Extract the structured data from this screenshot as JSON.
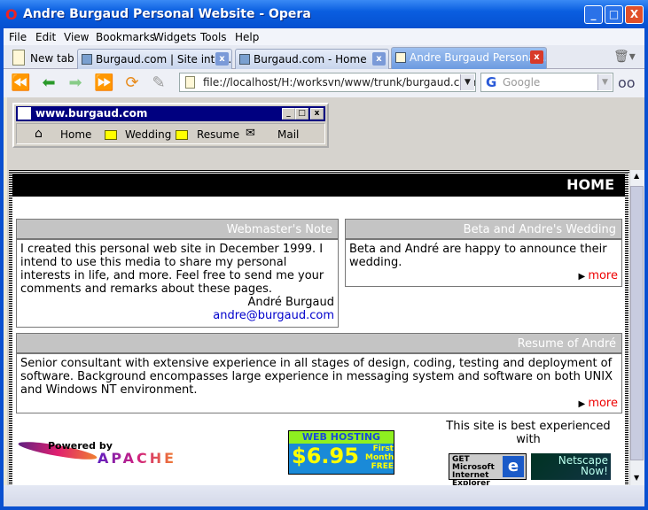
{
  "window": {
    "title": "Andre Burgaud Personal Website - Opera",
    "minimize": "_",
    "maximize": "□",
    "close": "X"
  },
  "menu": [
    "File",
    "Edit",
    "View",
    "Bookmarks",
    "Widgets",
    "Tools",
    "Help"
  ],
  "tabs": {
    "new_tab": "New tab",
    "items": [
      {
        "label": "Burgaud.com | Site inter...",
        "active": false
      },
      {
        "label": "Burgaud.com - Home",
        "active": false
      },
      {
        "label": "Andre Burgaud Personal ...",
        "active": true
      }
    ]
  },
  "toolbar": {
    "address": "file://localhost/H:/worksvn/www/trunk/burgaud.com/CURRE",
    "search_placeholder": "Google"
  },
  "mini_window": {
    "title": "www.burgaud.com",
    "items": [
      "Home",
      "Wedding",
      "Resume",
      "Mail"
    ]
  },
  "page": {
    "header": "HOME",
    "note": {
      "title": "Webmaster's Note",
      "text": "I created this personal web site in December 1999. I intend to use this media to share my personal interests in life, and more. Feel free to send me your comments and remarks about these pages.",
      "signature": "André Burgaud",
      "email": "andre@burgaud.com"
    },
    "wedding": {
      "title": "Beta and Andre's Wedding",
      "text": "Beta and André are happy to announce their wedding.",
      "more": "more"
    },
    "resume": {
      "title": "Resume of André",
      "text": "Senior consultant with extensive experience in all stages of design, coding, testing and deployment of software. Background encompasses large experience in messaging system and software on both UNIX and Windows NT environment.",
      "more": "more"
    },
    "footer": {
      "apache_top": "Powered by",
      "apache": "APACHE",
      "hosting_top": "WEB HOSTING",
      "hosting_price": "$6.95",
      "hosting_side": "First Month FREE",
      "best": "This site is best experienced with",
      "ie": "GET Microsoft Internet Explorer",
      "netscape": "Netscape Now!"
    }
  }
}
